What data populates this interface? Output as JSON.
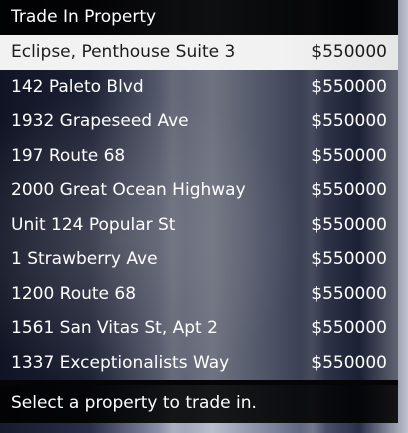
{
  "menu": {
    "title": "Trade In Property",
    "footer_hint": "Select a property to trade in.",
    "selected_index": 0,
    "items": [
      {
        "name": "Eclipse, Penthouse Suite 3",
        "price": "$550000"
      },
      {
        "name": "142 Paleto Blvd",
        "price": "$550000"
      },
      {
        "name": "1932 Grapeseed Ave",
        "price": "$550000"
      },
      {
        "name": "197 Route 68",
        "price": "$550000"
      },
      {
        "name": "2000 Great Ocean Highway",
        "price": "$550000"
      },
      {
        "name": "Unit 124 Popular St",
        "price": "$550000"
      },
      {
        "name": "1 Strawberry Ave",
        "price": "$550000"
      },
      {
        "name": "1200 Route 68",
        "price": "$550000"
      },
      {
        "name": "1561 San Vitas St, Apt 2",
        "price": "$550000"
      },
      {
        "name": "1337 Exceptionalists Way",
        "price": "$550000"
      }
    ]
  },
  "colors": {
    "header_bg": "#000000",
    "selected_bg": "#f2f2f2",
    "selected_text": "#1b1b1b",
    "text": "#ffffff"
  }
}
